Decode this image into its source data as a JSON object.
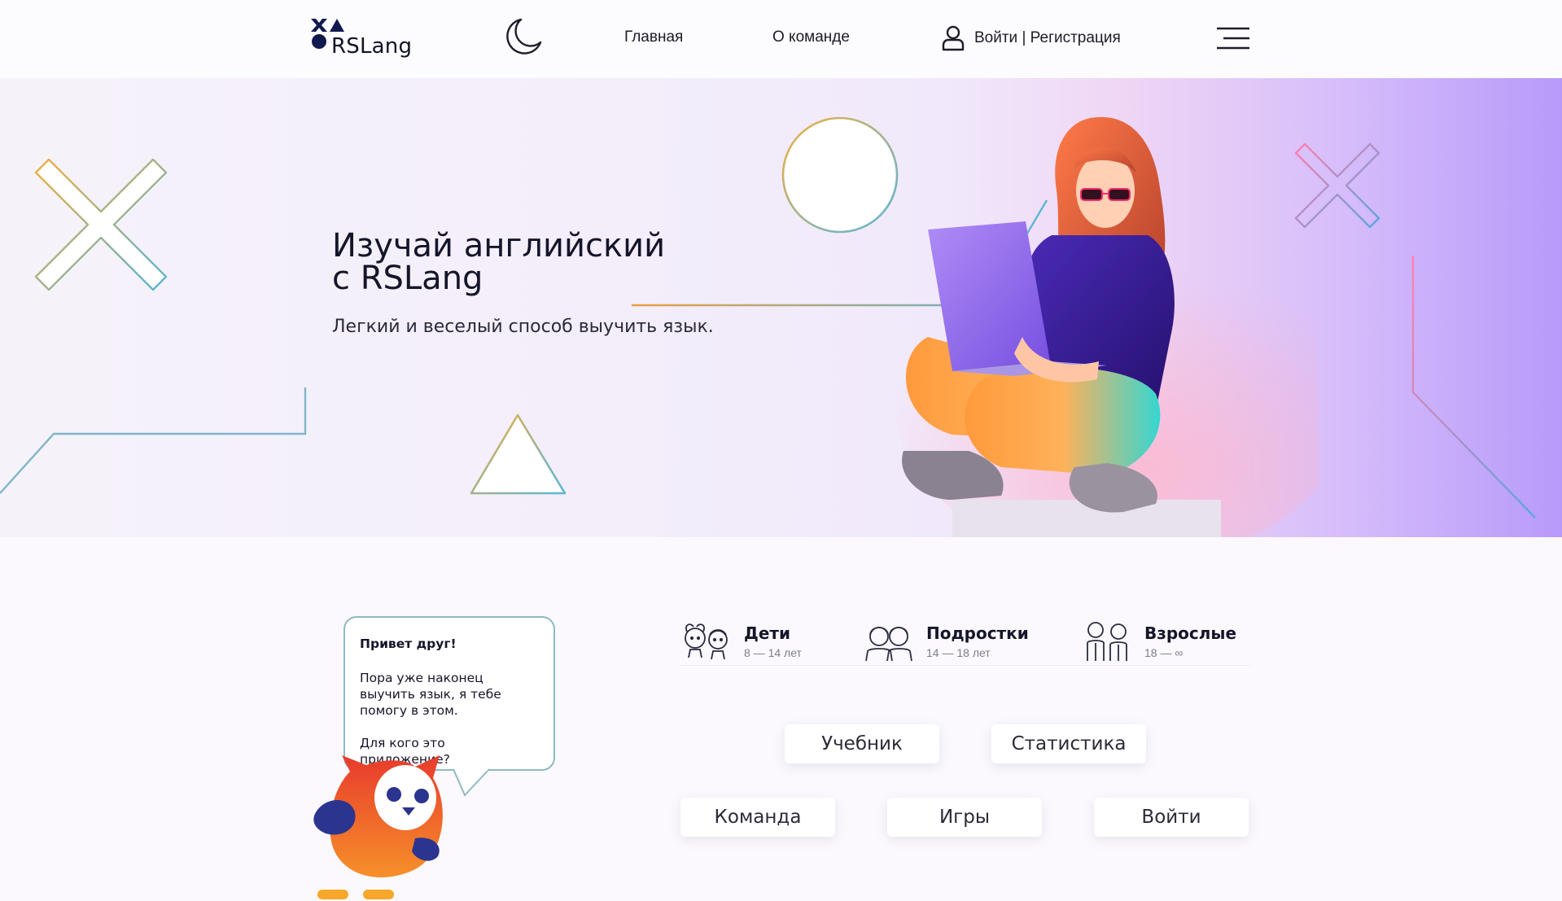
{
  "header": {
    "logo_text": "RSLang",
    "nav_home": "Главная",
    "nav_team": "О команде",
    "login_label": "Войти | Регистрация"
  },
  "hero": {
    "title_line1": "Изучай английский",
    "title_line2": "с RSLang",
    "subtitle": "Легкий и веселый способ выучить язык."
  },
  "bubble": {
    "greeting": "Привет друг!",
    "line1": "Пора уже наконец выучить язык, я тебе помогу в этом.",
    "question": "Для кого это приложение?"
  },
  "audiences": [
    {
      "title": "Дети",
      "ages": "8 — 14 лет"
    },
    {
      "title": "Подростки",
      "ages": "14 — 18 лет"
    },
    {
      "title": "Взрослые",
      "ages": "18 — ∞"
    }
  ],
  "buttons": {
    "textbook": "Учебник",
    "stats": "Статистика",
    "team": "Команда",
    "games": "Игры",
    "login": "Войти"
  },
  "colors": {
    "accent_navy": "#111a4f",
    "owl_orange": "#ee5a2a",
    "gradient_purple": "#b79afa"
  }
}
